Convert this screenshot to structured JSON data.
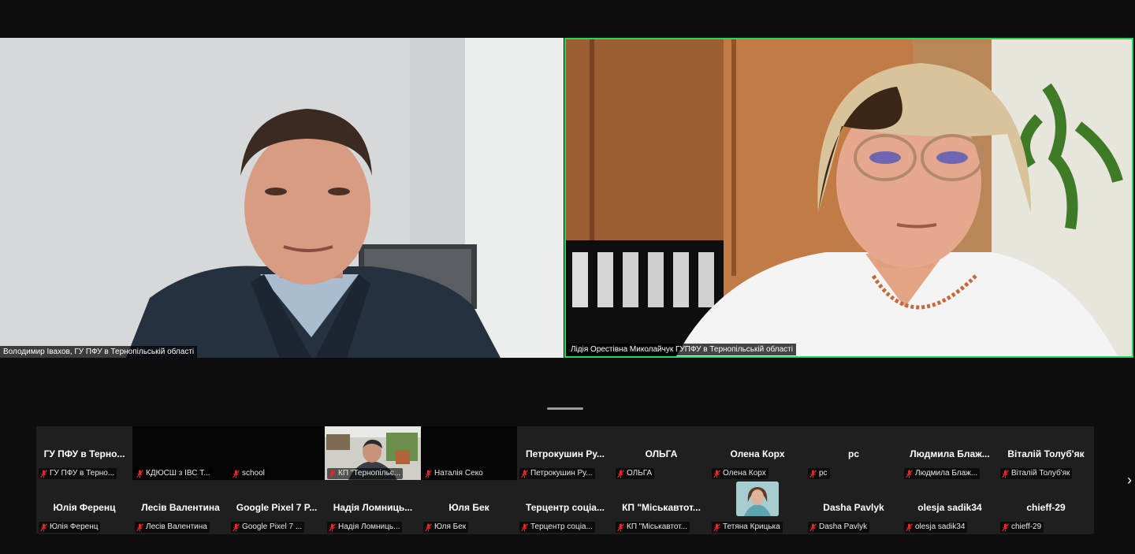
{
  "speakers": [
    {
      "name": "Володимир Івахов, ГУ ПФУ в Тернопільській області"
    },
    {
      "name": "Лідія Орестівна Миколайчук ГУПФУ в Тернопільській області"
    }
  ],
  "gallery": {
    "row1": [
      {
        "title": "ГУ ПФУ в Терно...",
        "label": "ГУ ПФУ в Терно..."
      },
      {
        "title": "",
        "label": "КДЮСШ з ІВС Т..."
      },
      {
        "title": "",
        "label": "school"
      },
      {
        "title": "",
        "label": "КП \"Тернопільє..."
      },
      {
        "title": "",
        "label": "Наталія Секо"
      },
      {
        "title": "Петрокушин Ру...",
        "label": "Петрокушин Ру..."
      },
      {
        "title": "ОЛЬГА",
        "label": "ОЛЬГА"
      },
      {
        "title": "Олена Корх",
        "label": "Олена Корх"
      },
      {
        "title": "pc",
        "label": "pc"
      },
      {
        "title": "Людмила Блаж...",
        "label": "Людмила Блаж..."
      },
      {
        "title": "Віталій Толуб'як",
        "label": "Віталій Толуб'як"
      }
    ],
    "row2": [
      {
        "title": "Юлія Ференц",
        "label": "Юлія Ференц"
      },
      {
        "title": "Лесів Валентина",
        "label": "Лесів Валентина"
      },
      {
        "title": "Google Pixel 7 P...",
        "label": "Google Pixel 7 ..."
      },
      {
        "title": "Надія Ломниць...",
        "label": "Надія Ломниць..."
      },
      {
        "title": "Юля Бек",
        "label": "Юля Бек"
      },
      {
        "title": "Терцентр соціа...",
        "label": "Терцентр соціа..."
      },
      {
        "title": "КП \"Міськавтот...",
        "label": "КП \"Міськавтот..."
      },
      {
        "title": "",
        "label": "Тетяна Крицька"
      },
      {
        "title": "Dasha Pavlyk",
        "label": "Dasha Pavlyk"
      },
      {
        "title": "olesja sadik34",
        "label": "olesja sadik34"
      },
      {
        "title": "chieff-29",
        "label": "chieff-29"
      }
    ]
  },
  "icons": {
    "mic": "muted-mic-icon",
    "next": "chevron-right-icon"
  },
  "colors": {
    "active_speaker_border": "#23d959",
    "muted_mic": "#e02828",
    "gallery_bg": "#1f1f1f",
    "app_bg": "#0d0d0d"
  },
  "nav": {
    "next_glyph": "›"
  }
}
